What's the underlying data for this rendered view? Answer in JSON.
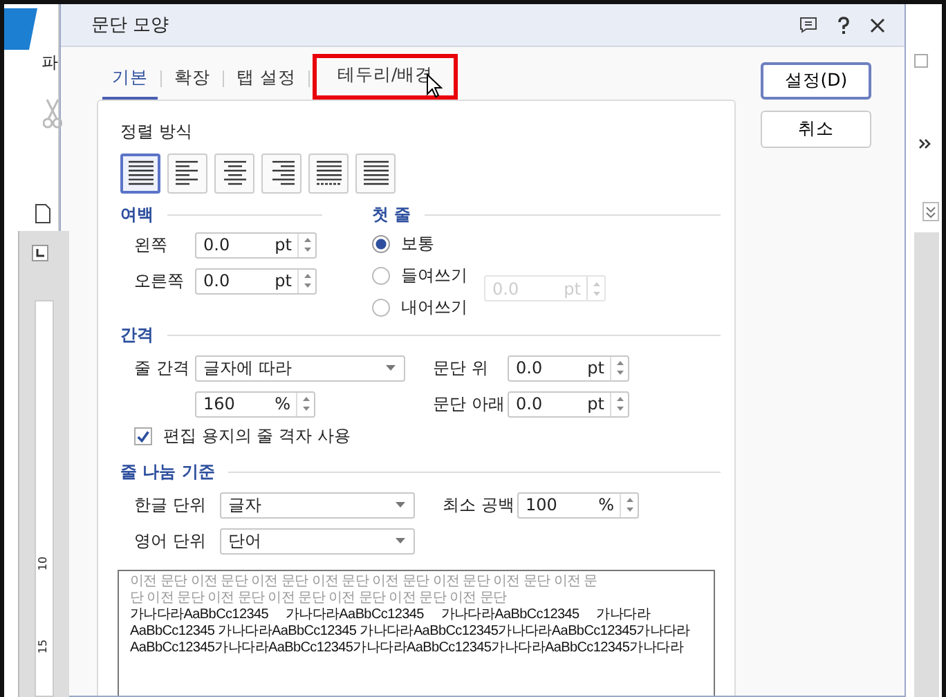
{
  "app": {
    "menu_label": "파",
    "ruler_labels": [
      "10",
      "15"
    ]
  },
  "dialog": {
    "title": "문단 모양",
    "tabs": [
      {
        "label": "기본",
        "selected": true,
        "highlighted": false
      },
      {
        "label": "확장",
        "selected": false,
        "highlighted": false
      },
      {
        "label": "탭 설정",
        "selected": false,
        "highlighted": false
      },
      {
        "label": "테두리/배경",
        "selected": false,
        "highlighted": true
      }
    ],
    "buttons": [
      {
        "label": "설정(D)",
        "default": true
      },
      {
        "label": "취소",
        "default": false
      }
    ],
    "alignment": {
      "label": "정렬 방식",
      "options": [
        {
          "kind": "justify",
          "selected": true
        },
        {
          "kind": "left",
          "selected": false
        },
        {
          "kind": "center",
          "selected": false
        },
        {
          "kind": "right",
          "selected": false
        },
        {
          "kind": "distribute",
          "selected": false
        },
        {
          "kind": "divide",
          "selected": false
        }
      ]
    },
    "margins": {
      "title": "여백",
      "fields": [
        {
          "label": "왼쪽",
          "value": "0.0",
          "unit": "pt"
        },
        {
          "label": "오른쪽",
          "value": "0.0",
          "unit": "pt"
        }
      ]
    },
    "first_line": {
      "title": "첫 줄",
      "options": [
        {
          "label": "보통",
          "selected": true
        },
        {
          "label": "들여쓰기",
          "selected": false
        },
        {
          "label": "내어쓰기",
          "selected": false
        }
      ],
      "field": {
        "value": "0.0",
        "unit": "pt",
        "disabled": true
      }
    },
    "spacing": {
      "title": "간격",
      "line_spacing": {
        "label": "줄 간격",
        "value": "글자에 따라"
      },
      "line_value": {
        "value": "160",
        "unit": "%"
      },
      "fields": [
        {
          "label": "문단 위",
          "value": "0.0",
          "unit": "pt"
        },
        {
          "label": "문단 아래",
          "value": "0.0",
          "unit": "pt"
        }
      ],
      "grid": {
        "label": "편집 용지의 줄 격자 사용",
        "checked": true
      }
    },
    "line_break": {
      "title": "줄 나눔 기준",
      "selects": [
        {
          "label": "한글 단위",
          "value": "글자"
        },
        {
          "label": "영어 단위",
          "value": "단어"
        }
      ],
      "min_space": {
        "label": "최소 공백",
        "value": "100",
        "unit": "%"
      }
    },
    "preview": [
      {
        "kind": "previous",
        "text": "이전 문단 이전 문단 이전 문단 이전 문단 이전 문단 이전 문단 이전 문단 이전 문"
      },
      {
        "kind": "previous",
        "text": "단 이전 문단 이전 문단 이전 문단 이전 문단 이전 문단 이전 문단"
      },
      {
        "kind": "sample",
        "text": "가나다라AaBbCc12345     가나다라AaBbCc12345     가나다라AaBbCc12345     가나다라"
      },
      {
        "kind": "sample",
        "text": "AaBbCc12345 가나다라AaBbCc12345 가나다라AaBbCc12345가나다라AaBbCc12345가나다라"
      },
      {
        "kind": "sample",
        "text": "AaBbCc12345가나다라AaBbCc12345가나다라AaBbCc12345가나다라AaBbCc12345가나다라"
      }
    ]
  }
}
